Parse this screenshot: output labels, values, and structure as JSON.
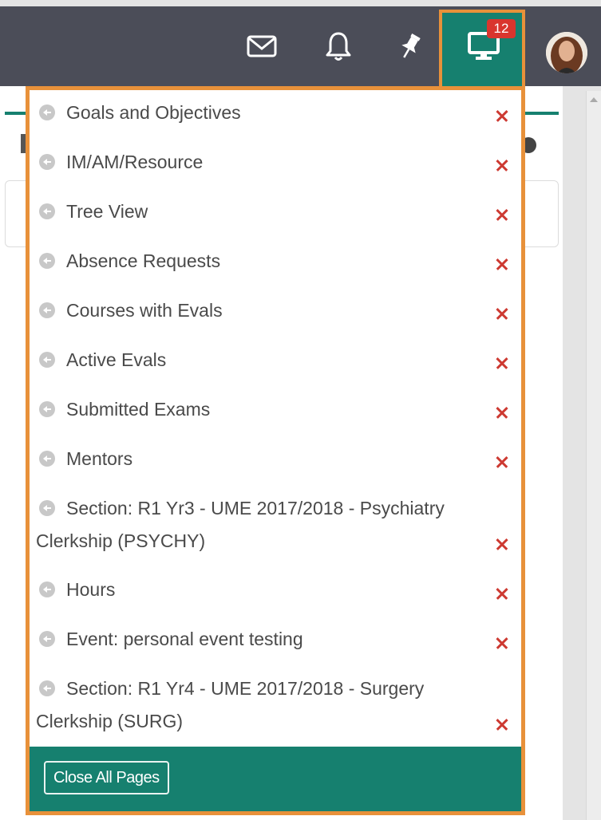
{
  "topbar": {
    "icons": [
      {
        "name": "mail-icon"
      },
      {
        "name": "bell-icon"
      },
      {
        "name": "pin-icon"
      }
    ],
    "open_pages_count": "12",
    "colors": {
      "bar": "#4b4d58",
      "teal": "#16806f",
      "highlight": "#e8913a",
      "badge": "#d9352e"
    }
  },
  "dropdown": {
    "items": [
      {
        "label": "Goals and Objectives"
      },
      {
        "label": "IM/AM/Resource"
      },
      {
        "label": "Tree View"
      },
      {
        "label": "Absence Requests"
      },
      {
        "label": "Courses with Evals"
      },
      {
        "label": "Active Evals"
      },
      {
        "label": "Submitted Exams"
      },
      {
        "label": "Mentors"
      },
      {
        "label": "Section: R1 Yr3 - UME 2017/2018 - Psychiatry Clerkship (PSYCHY)"
      },
      {
        "label": "Hours"
      },
      {
        "label": "Event: personal event testing"
      },
      {
        "label": "Section: R1 Yr4 - UME 2017/2018 - Surgery Clerkship (SURG)"
      }
    ],
    "close_all_label": "Close All Pages",
    "item_icon": "arrow-circle-left-icon",
    "remove_icon": "close-icon",
    "remove_color": "#cd3a32"
  }
}
